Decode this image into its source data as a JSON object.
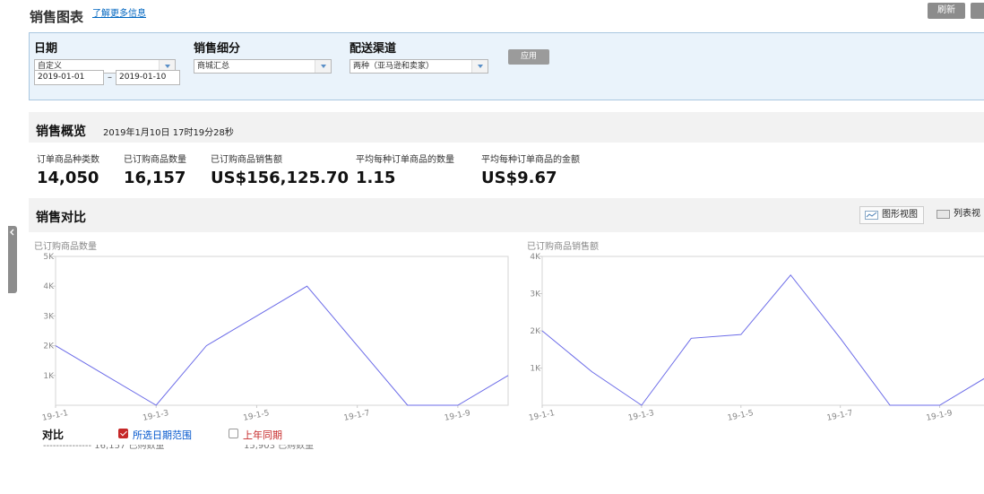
{
  "header": {
    "title": "销售图表",
    "learn_more": "了解更多信息",
    "refresh": "刷新"
  },
  "filters": {
    "date": {
      "label": "日期",
      "selected": "自定义",
      "start": "2019-01-01",
      "separator": "–",
      "end": "2019-01-10"
    },
    "breakdown": {
      "label": "销售细分",
      "selected": "商城汇总"
    },
    "channel": {
      "label": "配送渠道",
      "selected": "两种（亚马逊和卖家）"
    },
    "apply": "应用"
  },
  "overview": {
    "title": "销售概览",
    "timestamp": "2019年1月10日 17时19分28秒",
    "metrics": [
      {
        "label": "订单商品种类数",
        "value": "14,050"
      },
      {
        "label": "已订购商品数量",
        "value": "16,157"
      },
      {
        "label": "已订购商品销售额",
        "value": "US$156,125.70"
      },
      {
        "label": "平均每种订单商品的数量",
        "value": "1.15"
      },
      {
        "label": "平均每种订单商品的金额",
        "value": "US$9.67"
      }
    ]
  },
  "comparison": {
    "title": "销售对比",
    "graph_view": "图形视图",
    "list_view": "列表视",
    "contrast_title": "对比",
    "legend": [
      {
        "label": "所选日期范围",
        "checked": true,
        "color": "#0055cc"
      },
      {
        "label": "上年同期",
        "checked": false,
        "color": "#c62828"
      }
    ],
    "cutoff_left": "---------------  16,157 已购数量",
    "cutoff_right": "15,903 已购数量"
  },
  "chart_data": [
    {
      "type": "line",
      "title": "已订购商品数量",
      "x": [
        "19-1-1",
        "19-1-2",
        "19-1-3",
        "19-1-4",
        "19-1-5",
        "19-1-6",
        "19-1-7",
        "19-1-8",
        "19-1-9",
        "19-1-10"
      ],
      "x_tick_labels": [
        "19-1-1",
        "19-1-3",
        "19-1-5",
        "19-1-7",
        "19-1-9"
      ],
      "y_ticks": [
        "5K",
        "4K",
        "3K",
        "2K",
        "1K"
      ],
      "ylim": [
        0,
        5000
      ],
      "series": [
        {
          "color": "#6b6be8",
          "values": [
            2000,
            1000,
            0,
            2000,
            3000,
            4000,
            2000,
            0,
            0,
            1000
          ]
        }
      ]
    },
    {
      "type": "line",
      "title": "已订购商品销售额",
      "x": [
        "19-1-1",
        "19-1-2",
        "19-1-3",
        "19-1-4",
        "19-1-5",
        "19-1-6",
        "19-1-7",
        "19-1-8",
        "19-1-9",
        "19-1-10"
      ],
      "x_tick_labels": [
        "19-1-1",
        "19-1-3",
        "19-1-5",
        "19-1-7",
        "19-1-9"
      ],
      "y_ticks": [
        "4K",
        "3K",
        "2K",
        "1K"
      ],
      "ylim": [
        0,
        4000
      ],
      "series": [
        {
          "color": "#6b6be8",
          "values": [
            2000,
            900,
            0,
            1800,
            1900,
            3500,
            1800,
            0,
            0,
            800
          ]
        }
      ]
    }
  ]
}
